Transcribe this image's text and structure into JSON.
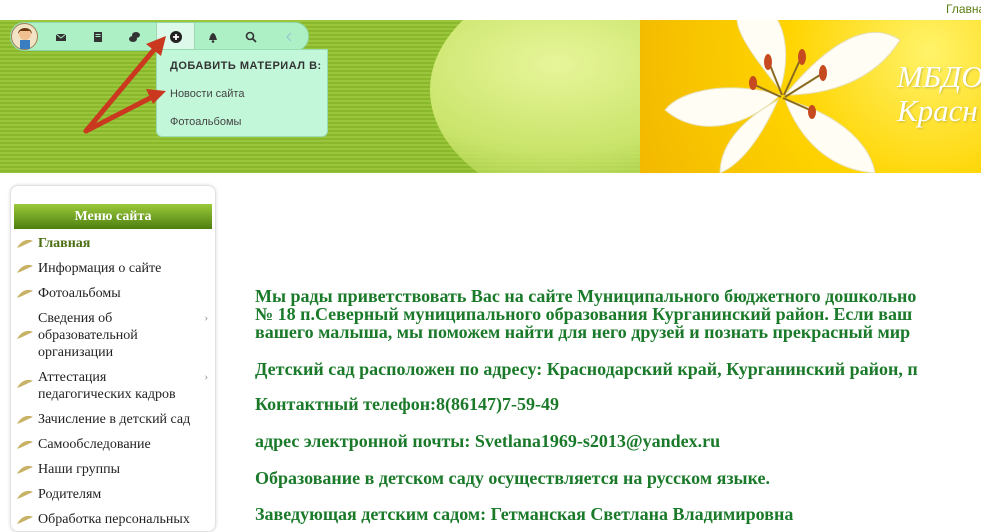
{
  "header": {
    "top_link": "Главна",
    "school_name_line1": "МБДО",
    "school_name_line2": "Красн"
  },
  "toolbar": {
    "buttons": [
      {
        "icon": "mail-icon"
      },
      {
        "icon": "document-icon"
      },
      {
        "icon": "chat-icon"
      },
      {
        "icon": "plus-circle-icon"
      },
      {
        "icon": "bell-icon"
      },
      {
        "icon": "search-icon"
      },
      {
        "icon": "chevron-left-icon"
      }
    ]
  },
  "dropdown": {
    "title": "ДОБАВИТЬ МАТЕРИАЛ В:",
    "items": [
      "Новости сайта",
      "Фотоальбомы"
    ]
  },
  "sidebar": {
    "title": "Меню сайта",
    "items": [
      "Главная",
      "Информация о сайте",
      "Фотоальбомы",
      "Сведения об образовательной организации",
      "Аттестация педагогических кадров",
      "Зачисление в детский сад",
      "Самообследование",
      "Наши группы",
      "Родителям",
      "Обработка персональных"
    ]
  },
  "content": {
    "p1_line1": "Мы рады приветствовать Вас на сайте Муниципального бюджетного дошкольно",
    "p1_line2": "№ 18 п.Северный муниципального образования Курганинский район. Если ваш",
    "p1_line3": "вашего малыша, мы поможем найти для него друзей и познать прекрасный мир",
    "p2": "Детский сад расположен по адресу: Краснодарский край, Курганинский район, п",
    "p3": "Контактный телефон:8(86147)7-59-49",
    "p4": "адрес электронной почты: Svetlana1969-s2013@yandex.ru",
    "p5": "Образование в детском саду осуществляется на русском языке.",
    "p6": "Заведующая детским садом: Гетманская Светлана Владимировна"
  },
  "colors": {
    "accent_green": "#1a7a2a",
    "toolbar_bg": "#adf0c6",
    "menu_header": "#6b9b1f"
  }
}
